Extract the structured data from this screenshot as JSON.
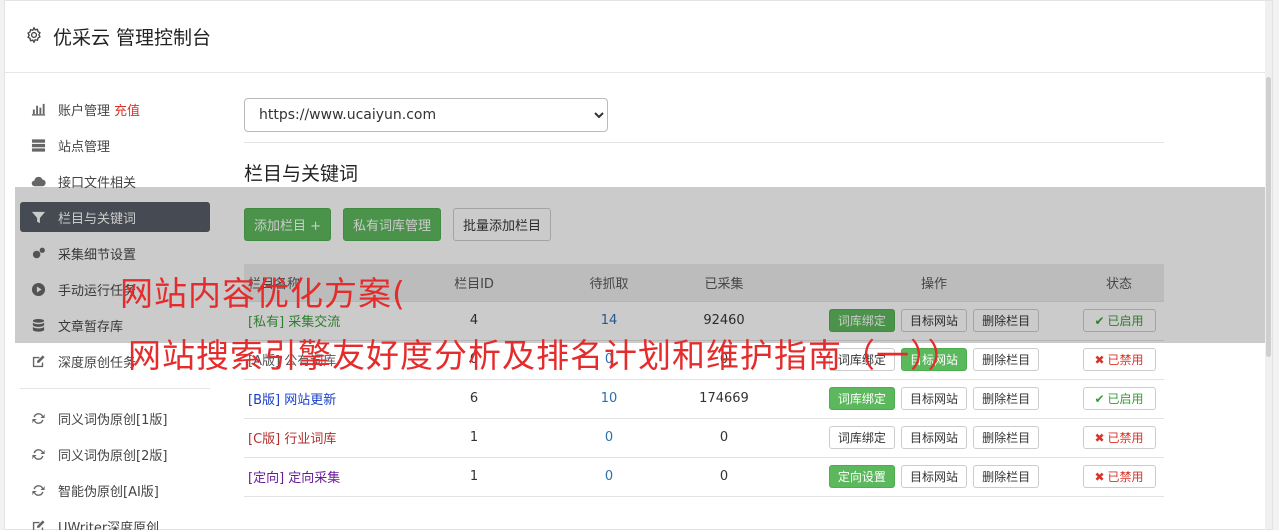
{
  "header": {
    "title": "优采云 管理控制台",
    "icon": "gear-icon"
  },
  "sidebar": {
    "group1": [
      {
        "label": "账户管理",
        "extra": "充值",
        "icon": "bar-chart-icon"
      },
      {
        "label": "站点管理",
        "icon": "server-icon"
      },
      {
        "label": "接口文件相关",
        "icon": "cloud-upload-icon"
      },
      {
        "label": "栏目与关键词",
        "icon": "filter-icon",
        "active": true
      },
      {
        "label": "采集细节设置",
        "icon": "cogs-icon"
      },
      {
        "label": "手动运行任务",
        "icon": "play-circle-icon"
      },
      {
        "label": "文章暂存库",
        "icon": "database-icon"
      },
      {
        "label": "深度原创任务",
        "icon": "edit-icon"
      }
    ],
    "group2": [
      {
        "label": "同义词伪原创[1版]",
        "icon": "refresh-icon"
      },
      {
        "label": "同义词伪原创[2版]",
        "icon": "refresh-icon"
      },
      {
        "label": "智能伪原创[AI版]",
        "icon": "refresh-icon"
      },
      {
        "label": "UWriter深度原创",
        "icon": "edit-icon"
      }
    ]
  },
  "main": {
    "site_select": {
      "value": "https://www.ucaiyun.com"
    },
    "section_title": "栏目与关键词",
    "buttons": {
      "add_column": "添加栏目 +",
      "private_lib": "私有词库管理",
      "batch_add": "批量添加栏目"
    },
    "table": {
      "headers": [
        "栏目名称",
        "栏目ID",
        "待抓取",
        "已采集",
        "操作",
        "状态"
      ],
      "rows": [
        {
          "tag": "[私有]",
          "name": "采集交流",
          "id": "4",
          "pending": "14",
          "collected": "92460",
          "op1": "词库绑定",
          "op2": "目标网站",
          "op3": "删除栏目",
          "status": "已启用",
          "on": true
        },
        {
          "tag": "[A版]",
          "name": "公有词库",
          "id": "0",
          "pending": "0",
          "collected": "0",
          "op1": "词库绑定",
          "op2": "目标网站",
          "op3": "删除栏目",
          "status": "已禁用",
          "on": false
        },
        {
          "tag": "[B版]",
          "name": "网站更新",
          "id": "6",
          "pending": "10",
          "collected": "174669",
          "op1": "词库绑定",
          "op2": "目标网站",
          "op3": "删除栏目",
          "status": "已启用",
          "on": true
        },
        {
          "tag": "[C版]",
          "name": "行业词库",
          "id": "1",
          "pending": "0",
          "collected": "0",
          "op1": "词库绑定",
          "op2": "目标网站",
          "op3": "删除栏目",
          "status": "已禁用",
          "on": false
        },
        {
          "tag": "[定向]",
          "name": "定向采集",
          "id": "1",
          "pending": "0",
          "collected": "0",
          "op1": "定向设置",
          "op2": "目标网站",
          "op3": "删除栏目",
          "status": "已禁用",
          "on": false
        }
      ]
    }
  },
  "overlay": {
    "line1": "网站内容优化方案(",
    "line2": "网站搜索引擎友好度分析及排名计划和维护指南（一））",
    "color": "#e42c2c"
  },
  "colors": {
    "accent_green": "#5cb85c",
    "active_nav": "#555c66",
    "danger": "#d9342b"
  }
}
